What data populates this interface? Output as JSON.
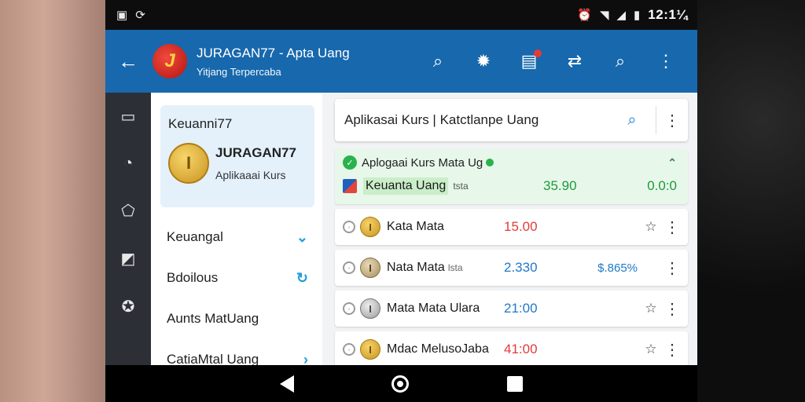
{
  "status_bar": {
    "time": "12:1¼",
    "icons": [
      "gallery-icon",
      "sync-icon",
      "alarm-icon",
      "wifi-icon",
      "signal-icon",
      "battery-icon"
    ]
  },
  "app_bar": {
    "title": "JURAGAN77 - Apta Uang",
    "subtitle": "Yitjang Terpercaba",
    "actions": [
      "search-icon",
      "settings-icon",
      "notification-icon",
      "sync-icon",
      "search-icon",
      "more-icon"
    ]
  },
  "drawer": {
    "header": "Keuanni77",
    "brand_name": "JURAGAN77",
    "brand_tagline": "Aplikaaai Kurs",
    "items": [
      {
        "label": "Keuangal",
        "icon": "chevron-down-icon"
      },
      {
        "label": "Bdoilous",
        "icon": "refresh-icon"
      },
      {
        "label": "Aunts MatUang",
        "icon": ""
      },
      {
        "label": "CatiaMtal Uang",
        "icon": "chevron-right-icon"
      }
    ]
  },
  "search": {
    "text": "Aplikasai Kurs | Katctlanpe Uang"
  },
  "highlight": {
    "title": "Aplogaai Kurs Mata Ug",
    "name": "Keuanta Uang",
    "small": "tsta",
    "value": "35.90",
    "change": "0.0:0"
  },
  "rows": [
    {
      "name": "Kata Mata",
      "small": "",
      "value": "15.00",
      "change": "",
      "coin": "gold",
      "action": "star",
      "color": "red"
    },
    {
      "name": "Nata Mata",
      "small": "lsta",
      "value": "2.330",
      "change": "$.865%",
      "coin": "tan",
      "action": "more",
      "color": "blue"
    },
    {
      "name": "Mata Mata Ulara",
      "small": "",
      "value": "21:00",
      "change": "",
      "coin": "silver",
      "action": "star",
      "color": "blue"
    },
    {
      "name": "Mdac MelusoJaba",
      "small": "",
      "value": "41:00",
      "change": "",
      "coin": "gold",
      "action": "star",
      "color": "red"
    }
  ],
  "colors": {
    "app_bar": "#1768ad",
    "accent": "#1e88d8",
    "positive": "#1e9a3a",
    "negative": "#e23b3b"
  }
}
